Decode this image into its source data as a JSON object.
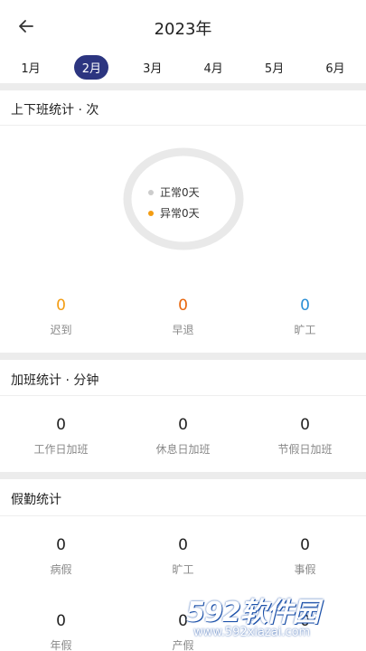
{
  "header": {
    "title": "2023年"
  },
  "months": [
    "1月",
    "2月",
    "3月",
    "4月",
    "5月",
    "6月"
  ],
  "attendance": {
    "title": "上下班统计 · 次",
    "legend": [
      {
        "label": "正常0天",
        "color": "#cccccc"
      },
      {
        "label": "异常0天",
        "color": "#f39c12"
      }
    ],
    "stats": [
      {
        "value": "0",
        "label": "迟到",
        "color": "#f39c12"
      },
      {
        "value": "0",
        "label": "早退",
        "color": "#e8660c"
      },
      {
        "value": "0",
        "label": "旷工",
        "color": "#2a8fd6"
      }
    ]
  },
  "overtime": {
    "title": "加班统计 · 分钟",
    "stats": [
      {
        "value": "0",
        "label": "工作日加班"
      },
      {
        "value": "0",
        "label": "休息日加班"
      },
      {
        "value": "0",
        "label": "节假日加班"
      }
    ]
  },
  "leave": {
    "title": "假勤统计",
    "stats": [
      {
        "value": "0",
        "label": "病假"
      },
      {
        "value": "0",
        "label": "旷工"
      },
      {
        "value": "0",
        "label": "事假"
      },
      {
        "value": "0",
        "label": "年假"
      },
      {
        "value": "0",
        "label": "产假"
      },
      {
        "value": "0",
        "label": ""
      }
    ]
  },
  "watermark": {
    "logo": "592软件园",
    "url": "www.592xiazai.com"
  }
}
